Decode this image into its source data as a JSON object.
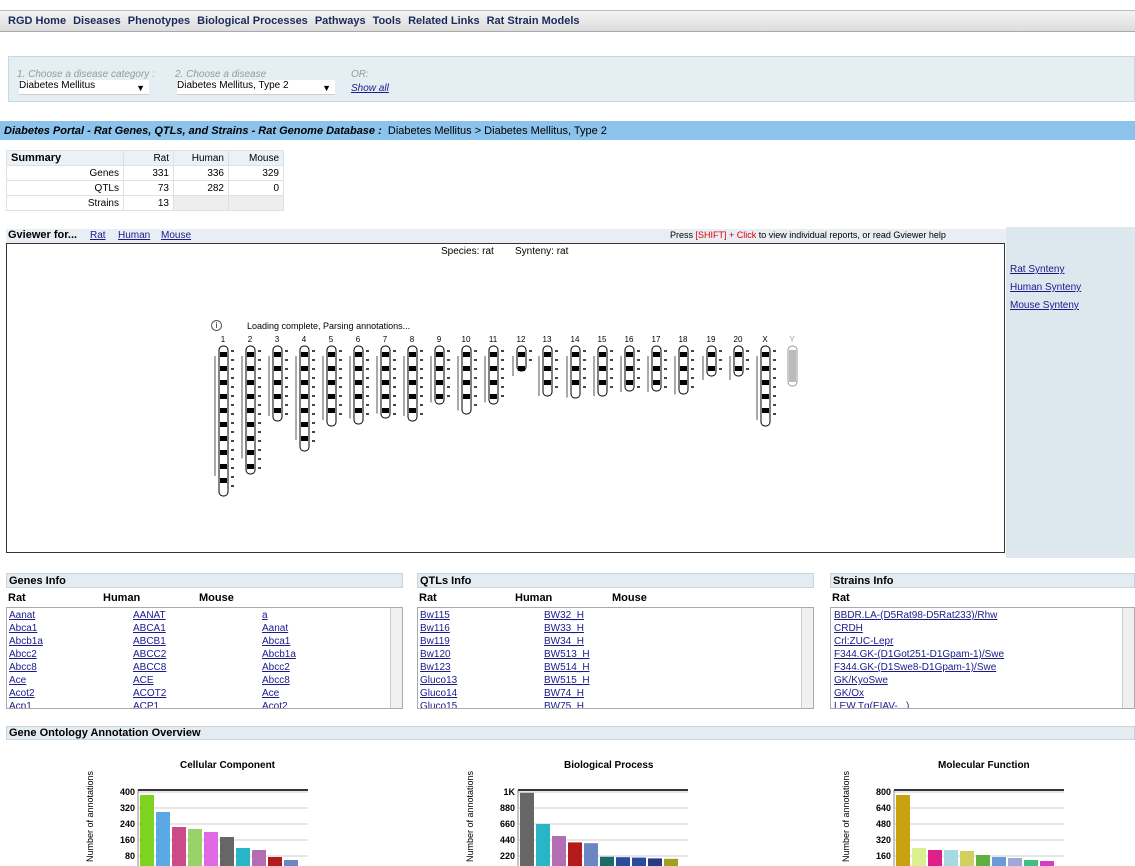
{
  "nav": [
    "RGD Home",
    "Diseases",
    "Phenotypes",
    "Biological Processes",
    "Pathways",
    "Tools",
    "Related Links",
    "Rat Strain Models"
  ],
  "choose": {
    "step1_label": "1. Choose a disease category :",
    "step1_value": "Diabetes Mellitus",
    "step2_label": "2. Choose a disease",
    "step2_value": "Diabetes Mellitus, Type 2",
    "or_label": "OR:",
    "show_all": "Show all"
  },
  "title": {
    "main": "Diabetes Portal - Rat Genes, QTLs, and Strains - Rat Genome Database :",
    "crumb": "Diabetes Mellitus > Diabetes Mellitus, Type 2"
  },
  "summary": {
    "header": "Summary",
    "columns": [
      "Rat",
      "Human",
      "Mouse"
    ],
    "rows": [
      {
        "label": "Genes",
        "values": [
          "331",
          "336",
          "329"
        ]
      },
      {
        "label": "QTLs",
        "values": [
          "73",
          "282",
          "0"
        ]
      },
      {
        "label": "Strains",
        "values": [
          "13",
          "",
          ""
        ]
      }
    ]
  },
  "gviewer": {
    "header": "Gviewer for...",
    "links": [
      "Rat",
      "Human",
      "Mouse"
    ],
    "hint_pre": "Press ",
    "hint_key": "[SHIFT] + Click",
    "hint_post": " to view individual reports, or read Gviewer help",
    "species": "Species: rat",
    "synteny": "Synteny: rat",
    "status": "Loading complete, Parsing annotations...",
    "info_icon": "i",
    "chromosomes": [
      "1",
      "2",
      "3",
      "4",
      "5",
      "6",
      "7",
      "8",
      "9",
      "10",
      "11",
      "12",
      "13",
      "14",
      "15",
      "16",
      "17",
      "18",
      "19",
      "20",
      "X",
      "Y"
    ],
    "side_links": [
      "Rat Synteny",
      "Human Synteny",
      "Mouse Synteny"
    ]
  },
  "genes": {
    "title": "Genes Info",
    "columns": [
      "Rat",
      "Human",
      "Mouse"
    ],
    "rows": [
      [
        "Aanat",
        "AANAT",
        "a"
      ],
      [
        "Abca1",
        "ABCA1",
        "Aanat"
      ],
      [
        "Abcb1a",
        "ABCB1",
        "Abca1"
      ],
      [
        "Abcc2",
        "ABCC2",
        "Abcb1a"
      ],
      [
        "Abcc8",
        "ABCC8",
        "Abcc2"
      ],
      [
        "Ace",
        "ACE",
        "Abcc8"
      ],
      [
        "Acot2",
        "ACOT2",
        "Ace"
      ],
      [
        "Acp1",
        "ACP1",
        "Acot2"
      ]
    ]
  },
  "qtls": {
    "title": "QTLs Info",
    "columns": [
      "Rat",
      "Human",
      "Mouse"
    ],
    "rows": [
      [
        "Bw115",
        "BW32_H"
      ],
      [
        "Bw116",
        "BW33_H"
      ],
      [
        "Bw119",
        "BW34_H"
      ],
      [
        "Bw120",
        "BW513_H"
      ],
      [
        "Bw123",
        "BW514_H"
      ],
      [
        "Gluco13",
        "BW515_H"
      ],
      [
        "Gluco14",
        "BW74_H"
      ],
      [
        "Gluco15",
        "BW75_H"
      ]
    ]
  },
  "strains": {
    "title": "Strains Info",
    "column": "Rat",
    "rows": [
      "BBDR.LA-(D5Rat98-D5Rat233)/Rhw",
      "CRDH",
      "Crl:ZUC-Lepr",
      "F344.GK-(D1Got251-D1Gpam-1)/Swe",
      "F344.GK-(D1Swe8-D1Gpam-1)/Swe",
      "GK/KyoSwe",
      "GK/Ox",
      "LEW.Tg(EIAV-...)"
    ]
  },
  "go": {
    "title": "Gene Ontology Annotation Overview",
    "ylabel": "Number of annotations"
  },
  "chart_data": [
    {
      "type": "bar",
      "title": "Cellular Component",
      "ylabel": "Number of annotations",
      "yticks": [
        "400",
        "320",
        "240",
        "160",
        "80"
      ],
      "ylim": [
        0,
        400
      ],
      "values": [
        385,
        300,
        225,
        215,
        200,
        175,
        120,
        110,
        75,
        60
      ],
      "colors": [
        "#7ed321",
        "#5aa9e6",
        "#cc4a8a",
        "#9bd16a",
        "#e06ae6",
        "#666666",
        "#29b5c8",
        "#b36db3",
        "#b31b1b",
        "#6b86c2"
      ]
    },
    {
      "type": "bar",
      "title": "Biological Process",
      "ylabel": "Number of annotations",
      "yticks": [
        "1K",
        "880",
        "660",
        "440",
        "220"
      ],
      "ylim": [
        0,
        1000
      ],
      "values": [
        990,
        600,
        450,
        370,
        360,
        190,
        185,
        180,
        170,
        165
      ],
      "colors": [
        "#666666",
        "#29b5c8",
        "#b36db3",
        "#b31b1b",
        "#6b86c2",
        "#1a6b6b",
        "#2a4aa0",
        "#2a4aa0",
        "#2a3a80",
        "#a0a020"
      ]
    },
    {
      "type": "bar",
      "title": "Molecular Function",
      "ylabel": "Number of annotations",
      "yticks": [
        "800",
        "640",
        "480",
        "320",
        "160"
      ],
      "ylim": [
        0,
        800
      ],
      "values": [
        770,
        240,
        220,
        220,
        210,
        170,
        150,
        140,
        120,
        110
      ],
      "colors": [
        "#c8a010",
        "#d8f090",
        "#e0208a",
        "#a8d8e0",
        "#d0d060",
        "#60b040",
        "#6a9ad8",
        "#a0a8d8",
        "#40c080",
        "#d040c0"
      ]
    }
  ]
}
